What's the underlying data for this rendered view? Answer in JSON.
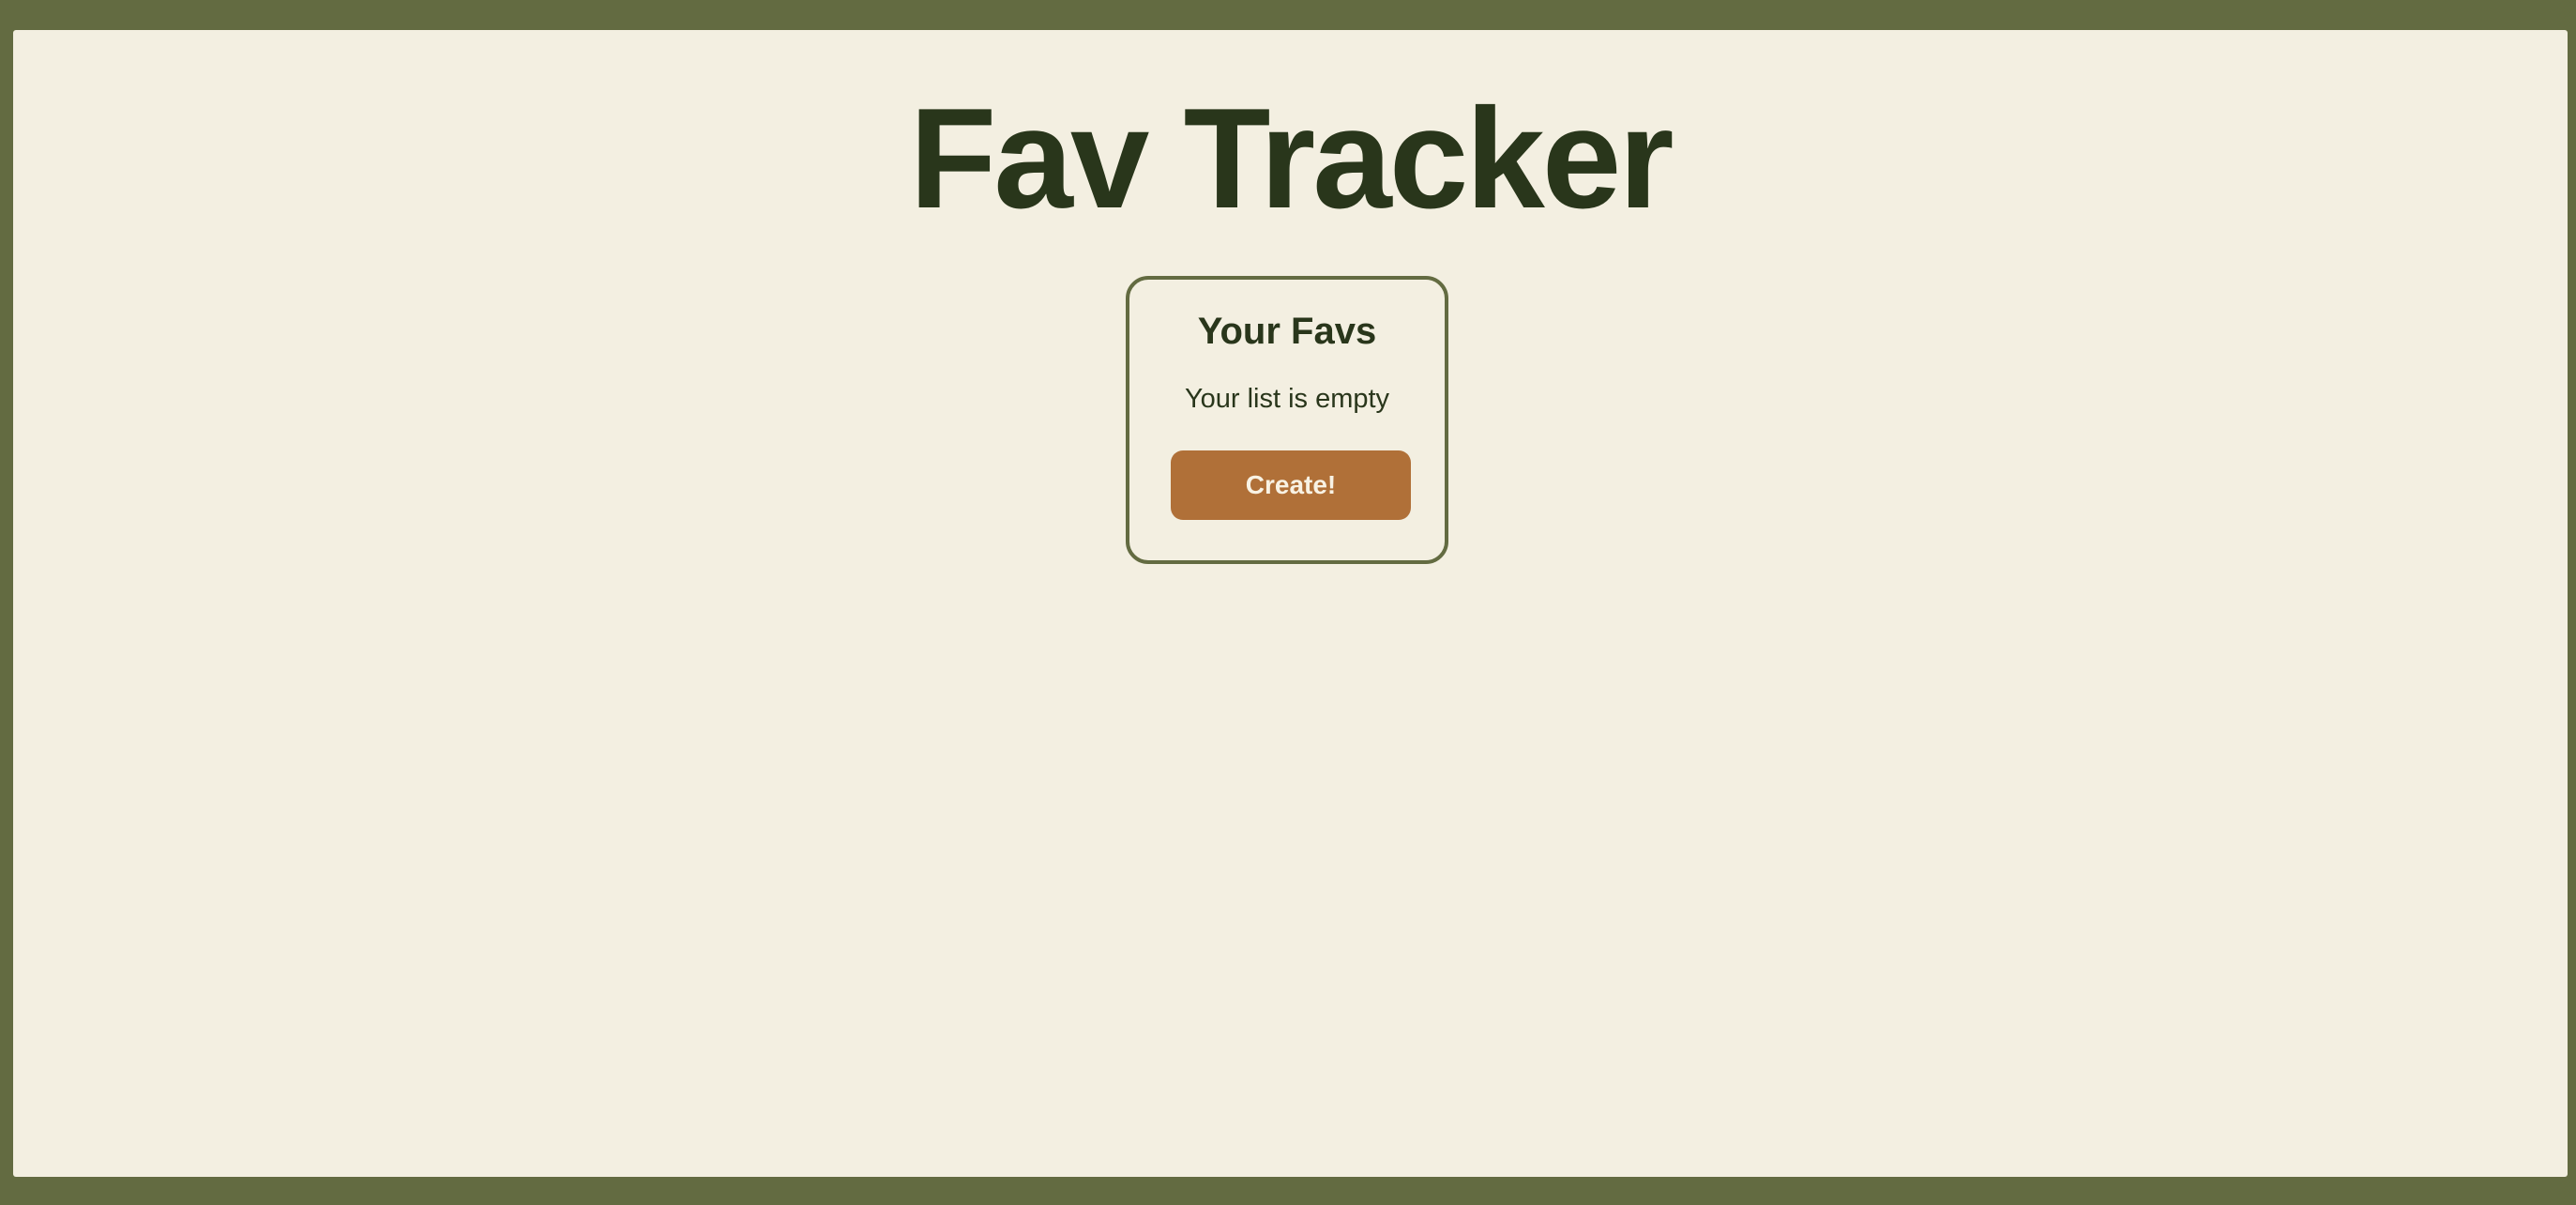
{
  "app": {
    "title": "Fav Tracker"
  },
  "favs_panel": {
    "title": "Your Favs",
    "empty_message": "Your list is empty",
    "create_label": "Create!"
  },
  "colors": {
    "frame": "#636b41",
    "background": "#f3efe1",
    "text": "#29361b",
    "accent": "#b07038",
    "button_text": "#f8f2e4"
  }
}
